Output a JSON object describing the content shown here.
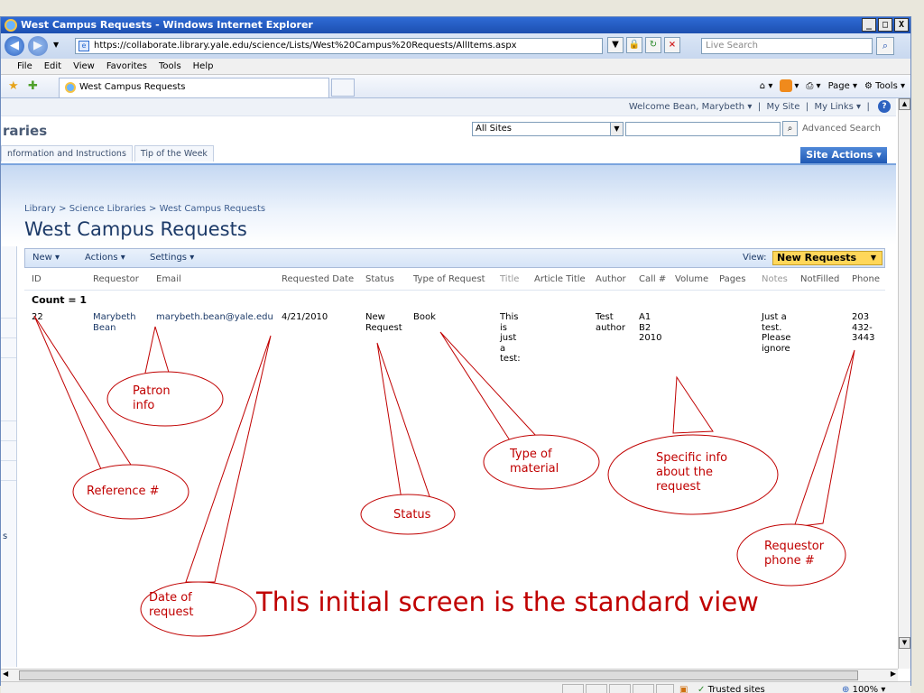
{
  "window": {
    "title": "West Campus Requests - Windows Internet Explorer",
    "minimize": "_",
    "maximize": "□",
    "close": "X"
  },
  "address_bar": {
    "url": "https://collaborate.library.yale.edu/science/Lists/West%20Campus%20Requests/AllItems.aspx",
    "search_placeholder": "Live Search"
  },
  "menu": [
    "File",
    "Edit",
    "View",
    "Favorites",
    "Tools",
    "Help"
  ],
  "tab": {
    "label": "West Campus Requests"
  },
  "command_bar": {
    "page": "Page",
    "tools": "Tools"
  },
  "sharepoint": {
    "welcome": "Welcome Bean, Marybeth ▾",
    "my_site": "My Site",
    "my_links": "My Links ▾",
    "site_title": "raries",
    "scope": "All Sites",
    "advanced_search": "Advanced Search",
    "nav_tabs": [
      "nformation and Instructions",
      "Tip of the Week"
    ],
    "site_actions": "Site Actions ▾",
    "breadcrumb": "Library > Science Libraries > West Campus Requests",
    "page_title": "West Campus Requests",
    "left_nav_letter": "s"
  },
  "list_toolbar": {
    "new": "New ▾",
    "actions": "Actions ▾",
    "settings": "Settings ▾",
    "view_label": "View:",
    "view_value": "New Requests"
  },
  "table": {
    "columns": [
      "ID",
      "Requestor",
      "Email",
      "Requested Date",
      "Status",
      "Type of Request",
      "Title",
      "Article Title",
      "Author",
      "Call #",
      "Volume",
      "Pages",
      "Notes",
      "NotFilled",
      "Phone"
    ],
    "count": "Count = 1",
    "row": {
      "id": "22",
      "requestor": "Marybeth\nBean",
      "email": "marybeth.bean@yale.edu",
      "date": "4/21/2010",
      "status": "New\nRequest",
      "type": "Book",
      "title": "This\nis\njust\na\ntest:",
      "author": "Test\nauthor",
      "call": "A1\nB2\n2010",
      "notes": "Just a\ntest.\nPlease\nignore",
      "phone": "203\n432-\n3443"
    }
  },
  "status_bar": {
    "zone": "Trusted sites",
    "zoom": "100%"
  },
  "annotations": {
    "patron_info": "Patron\ninfo",
    "reference": "Reference #",
    "type_of_material": "Type of\nmaterial",
    "specific_info": "Specific info\nabout the\nrequest",
    "status": "Status",
    "requestor_phone": "Requestor\nphone #",
    "date_of_request": "Date of\nrequest",
    "headline": "This initial screen is the standard view"
  },
  "colors": {
    "annotation": "#c00000",
    "view_highlight": "#ffd75a",
    "title_bar": "#1d4fb0"
  }
}
